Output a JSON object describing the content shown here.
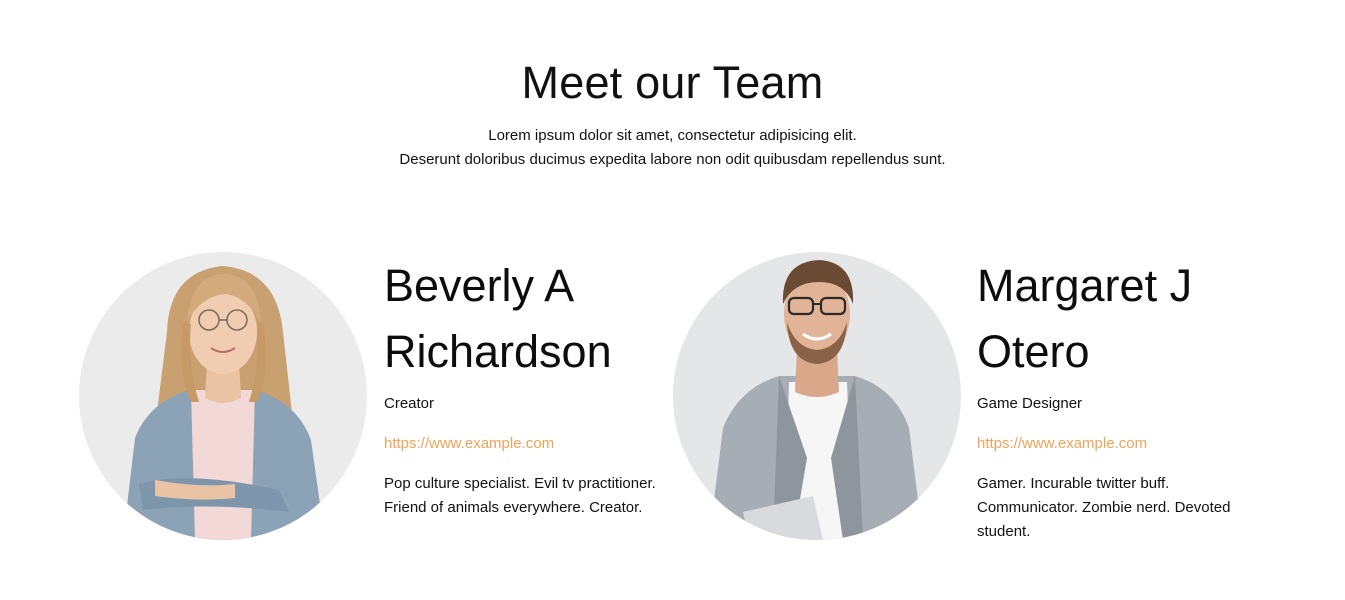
{
  "header": {
    "title": "Meet our Team",
    "subtitle_line1": "Lorem ipsum dolor sit amet, consectetur adipisicing elit.",
    "subtitle_line2": "Deserunt doloribus ducimus expedita labore non odit quibusdam repellendus sunt."
  },
  "members": [
    {
      "name_line1": "Beverly A",
      "name_line2": "Richardson",
      "role": "Creator",
      "link": "https://www.example.com",
      "bio": "Pop culture specialist. Evil tv practitioner. Friend of animals everywhere. Creator."
    },
    {
      "name_line1": "Margaret J",
      "name_line2": "Otero",
      "role": "Game Designer",
      "link": "https://www.example.com",
      "bio": "Gamer. Incurable twitter buff. Communicator. Zombie nerd. Devoted student."
    }
  ],
  "colors": {
    "accent_link": "#f0a259",
    "photo_background": "#e8e8ea"
  }
}
